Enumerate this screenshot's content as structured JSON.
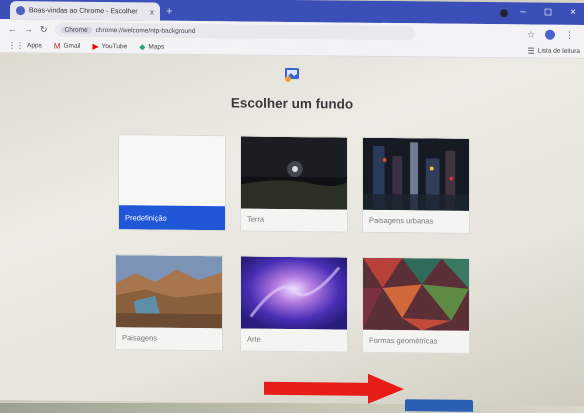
{
  "browser": {
    "tab_title": "Boas-vindas ao Chrome - Escolher",
    "tab_close": "x",
    "new_tab": "+",
    "omnibox_chip": "Chrome",
    "url": "chrome://welcome/ntp-background",
    "window_controls": [
      "–",
      "◻",
      "×"
    ]
  },
  "bookmarks": [
    {
      "icon": "apps-icon",
      "label": "Apps"
    },
    {
      "icon": "gmail-icon",
      "label": "Gmail"
    },
    {
      "icon": "youtube-icon",
      "label": "YouTube"
    },
    {
      "icon": "maps-icon",
      "label": "Maps"
    }
  ],
  "bookmarks_right": "Lista de leitura",
  "page": {
    "heading": "Escolher um fundo",
    "options": [
      {
        "label": "Predefinição",
        "selected": true
      },
      {
        "label": "Terra",
        "selected": false
      },
      {
        "label": "Paisagens urbanas",
        "selected": false
      },
      {
        "label": "Paisagens",
        "selected": false
      },
      {
        "label": "Arte",
        "selected": false
      },
      {
        "label": "Formas geométricas",
        "selected": false
      }
    ]
  },
  "colors": {
    "accent": "#1f57d6",
    "arrow": "#e81c18",
    "tabbar": "#3b4fb8"
  }
}
